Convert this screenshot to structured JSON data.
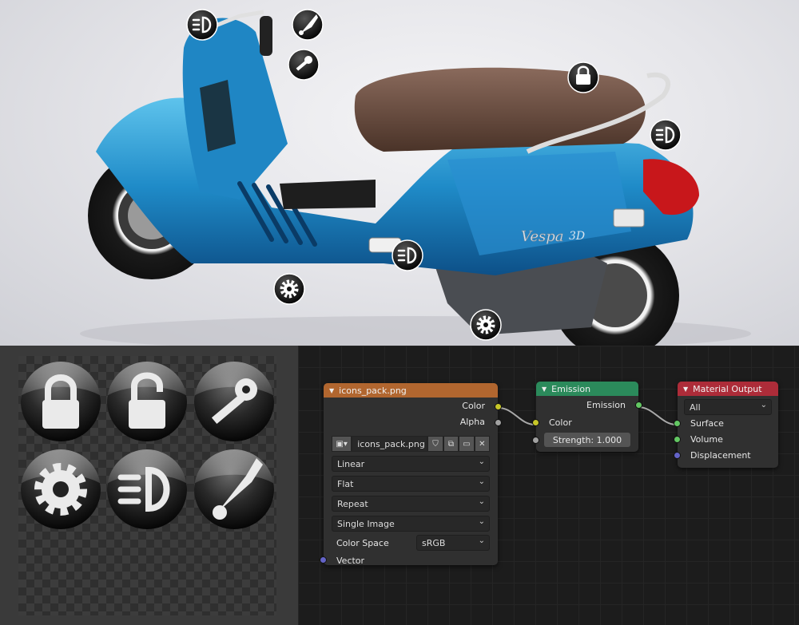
{
  "viewport": {
    "badge_text": "Vespa",
    "badge_suffix": "3D",
    "hotspots": [
      {
        "icon": "headlight-icon"
      },
      {
        "icon": "horn-icon"
      },
      {
        "icon": "key-icon"
      },
      {
        "icon": "lock-closed-icon"
      },
      {
        "icon": "headlight-icon"
      },
      {
        "icon": "headlight-icon"
      },
      {
        "icon": "gear-icon"
      },
      {
        "icon": "gear-icon"
      }
    ]
  },
  "image_editor": {
    "icons": [
      "lock-closed-icon",
      "lock-open-icon",
      "key-icon",
      "gear-icon",
      "headlight-icon",
      "horn-icon"
    ]
  },
  "nodes": {
    "image_texture": {
      "title": "icons_pack.png",
      "color": "#b1662f",
      "outputs": [
        "Color",
        "Alpha"
      ],
      "image_name": "icons_pack.png",
      "interpolation": "Linear",
      "projection": "Flat",
      "extension": "Repeat",
      "source": "Single Image",
      "color_space_label": "Color Space",
      "color_space_value": "sRGB",
      "inputs": [
        "Vector"
      ]
    },
    "emission": {
      "title": "Emission",
      "color": "#2b8a5b",
      "output": "Emission",
      "color_input": "Color",
      "strength_label": "Strength:",
      "strength_value": "1.000"
    },
    "material_output": {
      "title": "Material Output",
      "color": "#ad2c39",
      "target": "All",
      "inputs": [
        "Surface",
        "Volume",
        "Displacement"
      ]
    }
  }
}
